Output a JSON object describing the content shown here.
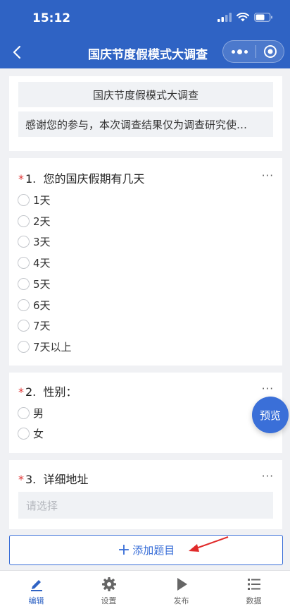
{
  "status_bar": {
    "time": "15:12"
  },
  "nav": {
    "title": "国庆节度假模式大调查"
  },
  "intro": {
    "title": "国庆节度假模式大调查",
    "description": "感谢您的参与，本次调查结果仅为调查研究使…"
  },
  "questions": [
    {
      "required_mark": "*",
      "number": "1.",
      "title": "您的国庆假期有几天",
      "options": [
        "1天",
        "2天",
        "3天",
        "4天",
        "5天",
        "6天",
        "7天",
        "7天以上"
      ]
    },
    {
      "required_mark": "*",
      "number": "2.",
      "title": "性别：",
      "options": [
        "男",
        "女"
      ]
    },
    {
      "required_mark": "*",
      "number": "3.",
      "title": "详细地址",
      "placeholder": "请选择"
    }
  ],
  "more_label": "···",
  "preview_button": "预览",
  "add_question": {
    "icon": "+",
    "label": "添加题目"
  },
  "tabs": [
    {
      "icon": "edit-icon",
      "label": "编辑",
      "active": true
    },
    {
      "icon": "settings-icon",
      "label": "设置",
      "active": false
    },
    {
      "icon": "publish-icon",
      "label": "发布",
      "active": false
    },
    {
      "icon": "data-list-icon",
      "label": "数据",
      "active": false
    }
  ],
  "colors": {
    "primary": "#2f63c4",
    "button_blue": "#3a6fd8",
    "required": "#e03a3a",
    "annotation_arrow": "#e02a2a"
  }
}
